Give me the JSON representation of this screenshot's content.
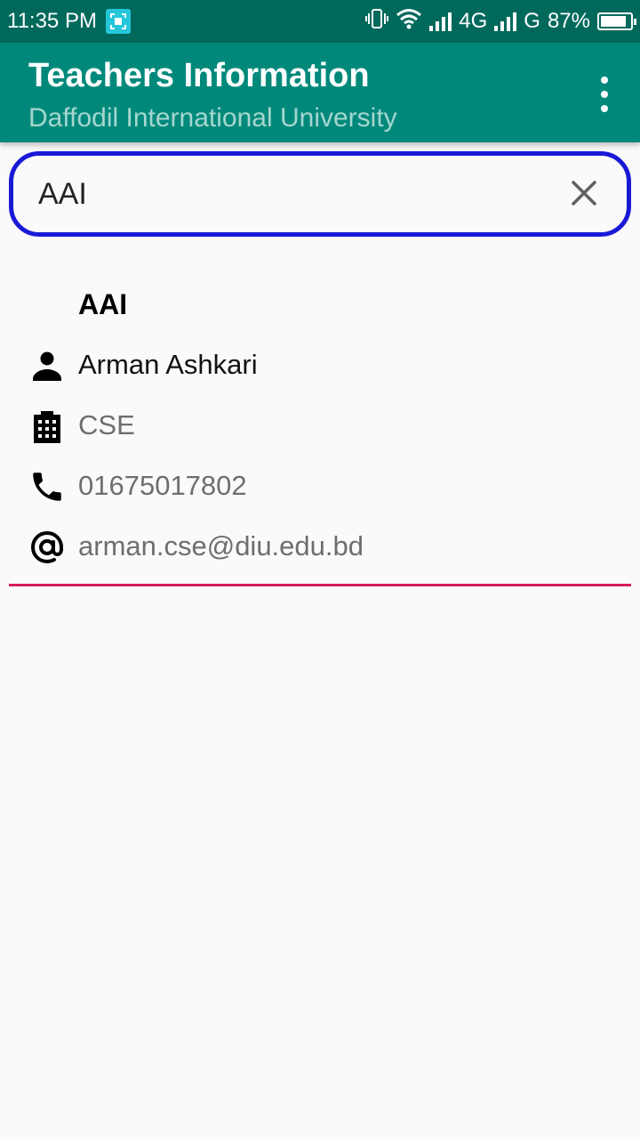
{
  "status_bar": {
    "time": "11:35 PM",
    "network1": "4G",
    "network2": "G",
    "battery": "87%",
    "battery_level": 0.87
  },
  "app_bar": {
    "title": "Teachers Information",
    "subtitle": "Daffodil International University"
  },
  "search": {
    "value": "AAI"
  },
  "result": {
    "initials": "AAI",
    "name": "Arman Ashkari",
    "department": "CSE",
    "phone": "01675017802",
    "email": "arman.cse@diu.edu.bd"
  },
  "colors": {
    "status_bar": "#00695c",
    "app_bar": "#00897b",
    "search_border": "#1a1ad6",
    "divider": "#d81b60"
  }
}
